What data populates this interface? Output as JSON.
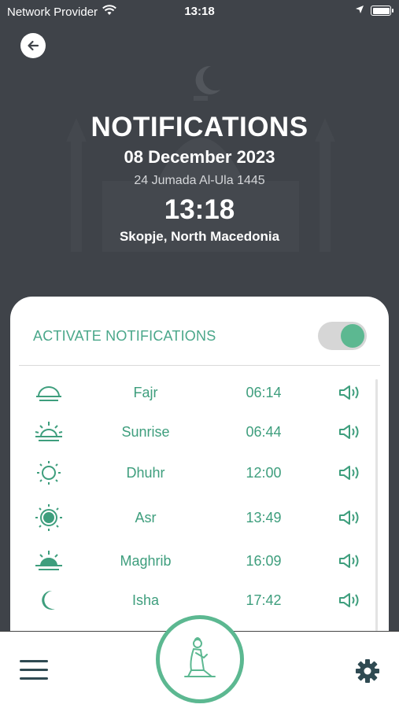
{
  "status_bar": {
    "carrier": "Network Provider",
    "time": "13:18"
  },
  "header": {
    "title": "NOTIFICATIONS",
    "gregorian_date": "08 December 2023",
    "hijri_date": "24 Jumada Al-Ula 1445",
    "clock": "13:18",
    "location": "Skopje, North Macedonia"
  },
  "notifications": {
    "activate_label": "ACTIVATE NOTIFICATIONS",
    "enabled": true
  },
  "prayers": [
    {
      "name": "Fajr",
      "time": "06:14",
      "icon": "dawn-icon"
    },
    {
      "name": "Sunrise",
      "time": "06:44",
      "icon": "sunrise-icon"
    },
    {
      "name": "Dhuhr",
      "time": "12:00",
      "icon": "sun-icon"
    },
    {
      "name": "Asr",
      "time": "13:49",
      "icon": "sun-filled-icon"
    },
    {
      "name": "Maghrib",
      "time": "16:09",
      "icon": "sunset-icon"
    },
    {
      "name": "Isha",
      "time": "17:42",
      "icon": "crescent-moon-icon"
    }
  ],
  "colors": {
    "header_background": "#3f4349",
    "accent": "#5cb891",
    "text_green": "#3e9e7d",
    "nav_dark": "#2f4a52"
  }
}
